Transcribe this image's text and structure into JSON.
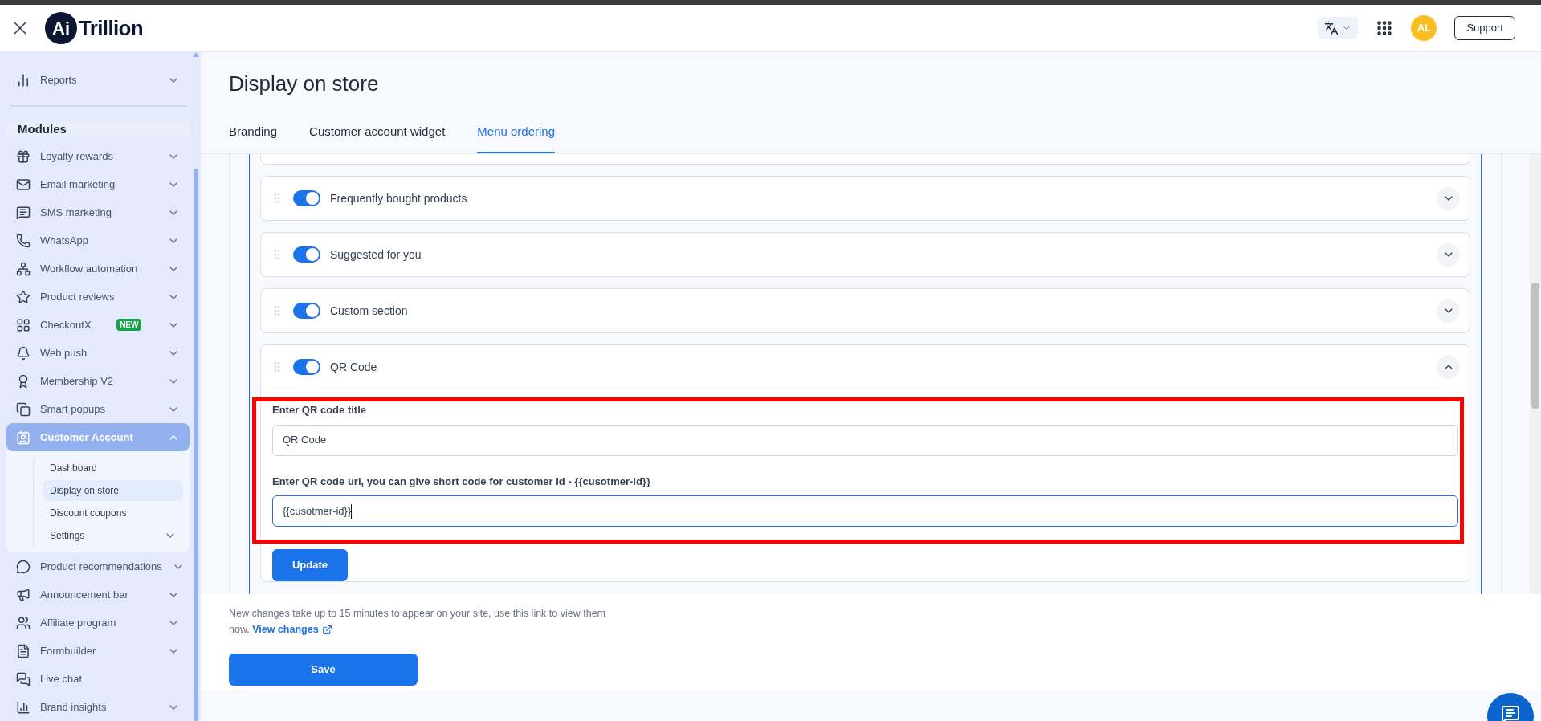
{
  "header": {
    "logo_mark": "Ai",
    "logo_name": "Trillion",
    "avatar": "AL",
    "support_button": "Support"
  },
  "sidebar": {
    "top_items": [
      {
        "label": "Reports",
        "expandable": true,
        "expanded": false
      }
    ],
    "section_title": "Modules",
    "items": [
      {
        "label": "Loyalty rewards",
        "expandable": true,
        "expanded": false,
        "selected": false
      },
      {
        "label": "Email marketing",
        "expandable": true,
        "expanded": false,
        "selected": false
      },
      {
        "label": "SMS marketing",
        "expandable": true,
        "expanded": false,
        "selected": false
      },
      {
        "label": "WhatsApp",
        "expandable": true,
        "expanded": false,
        "selected": false
      },
      {
        "label": "Workflow automation",
        "expandable": true,
        "expanded": false,
        "selected": false
      },
      {
        "label": "Product reviews",
        "expandable": true,
        "expanded": false,
        "selected": false
      },
      {
        "label": "CheckoutX",
        "badge": "NEW",
        "expandable": true,
        "expanded": false,
        "selected": false
      },
      {
        "label": "Web push",
        "expandable": true,
        "expanded": false,
        "selected": false
      },
      {
        "label": "Membership V2",
        "expandable": true,
        "expanded": false,
        "selected": false
      },
      {
        "label": "Smart popups",
        "expandable": true,
        "expanded": false,
        "selected": false
      },
      {
        "label": "Customer Account",
        "expandable": true,
        "expanded": true,
        "selected": true,
        "children": [
          {
            "label": "Dashboard",
            "selected": false,
            "expandable": false
          },
          {
            "label": "Display on store",
            "selected": true,
            "expandable": false
          },
          {
            "label": "Discount coupons",
            "selected": false,
            "expandable": false
          },
          {
            "label": "Settings",
            "selected": false,
            "expandable": true
          }
        ]
      },
      {
        "label": "Product recommendations",
        "expandable": true,
        "expanded": false,
        "selected": false
      },
      {
        "label": "Announcement bar",
        "expandable": true,
        "expanded": false,
        "selected": false
      },
      {
        "label": "Affiliate program",
        "expandable": true,
        "expanded": false,
        "selected": false
      },
      {
        "label": "Formbuilder",
        "expandable": true,
        "expanded": false,
        "selected": false
      },
      {
        "label": "Live chat",
        "expandable": false,
        "expanded": false,
        "selected": false
      },
      {
        "label": "Brand insights",
        "expandable": true,
        "expanded": false,
        "selected": false
      }
    ]
  },
  "page": {
    "title": "Display on store",
    "tabs": [
      {
        "label": "Branding",
        "selected": false
      },
      {
        "label": "Customer account widget",
        "selected": false
      },
      {
        "label": "Menu ordering",
        "selected": true
      }
    ],
    "sections": [
      {
        "label": "Frequently bought products",
        "on": true,
        "expanded": false
      },
      {
        "label": "Suggested for you",
        "on": true,
        "expanded": false
      },
      {
        "label": "Custom section",
        "on": true,
        "expanded": false
      },
      {
        "label": "QR Code",
        "on": true,
        "expanded": true,
        "button": "Update",
        "fields": [
          {
            "label": "Enter QR code title",
            "value": "QR Code",
            "focused": false
          },
          {
            "label": "Enter QR code url, you can give short code for customer id - {{cusotmer-id}}",
            "value": "{{cusotmer-id}}",
            "focused": true
          }
        ]
      }
    ]
  },
  "footer": {
    "note": "New changes take up to 15 minutes to appear on your site, use this link to view them now.",
    "link": "View changes",
    "save_button": "Save"
  }
}
